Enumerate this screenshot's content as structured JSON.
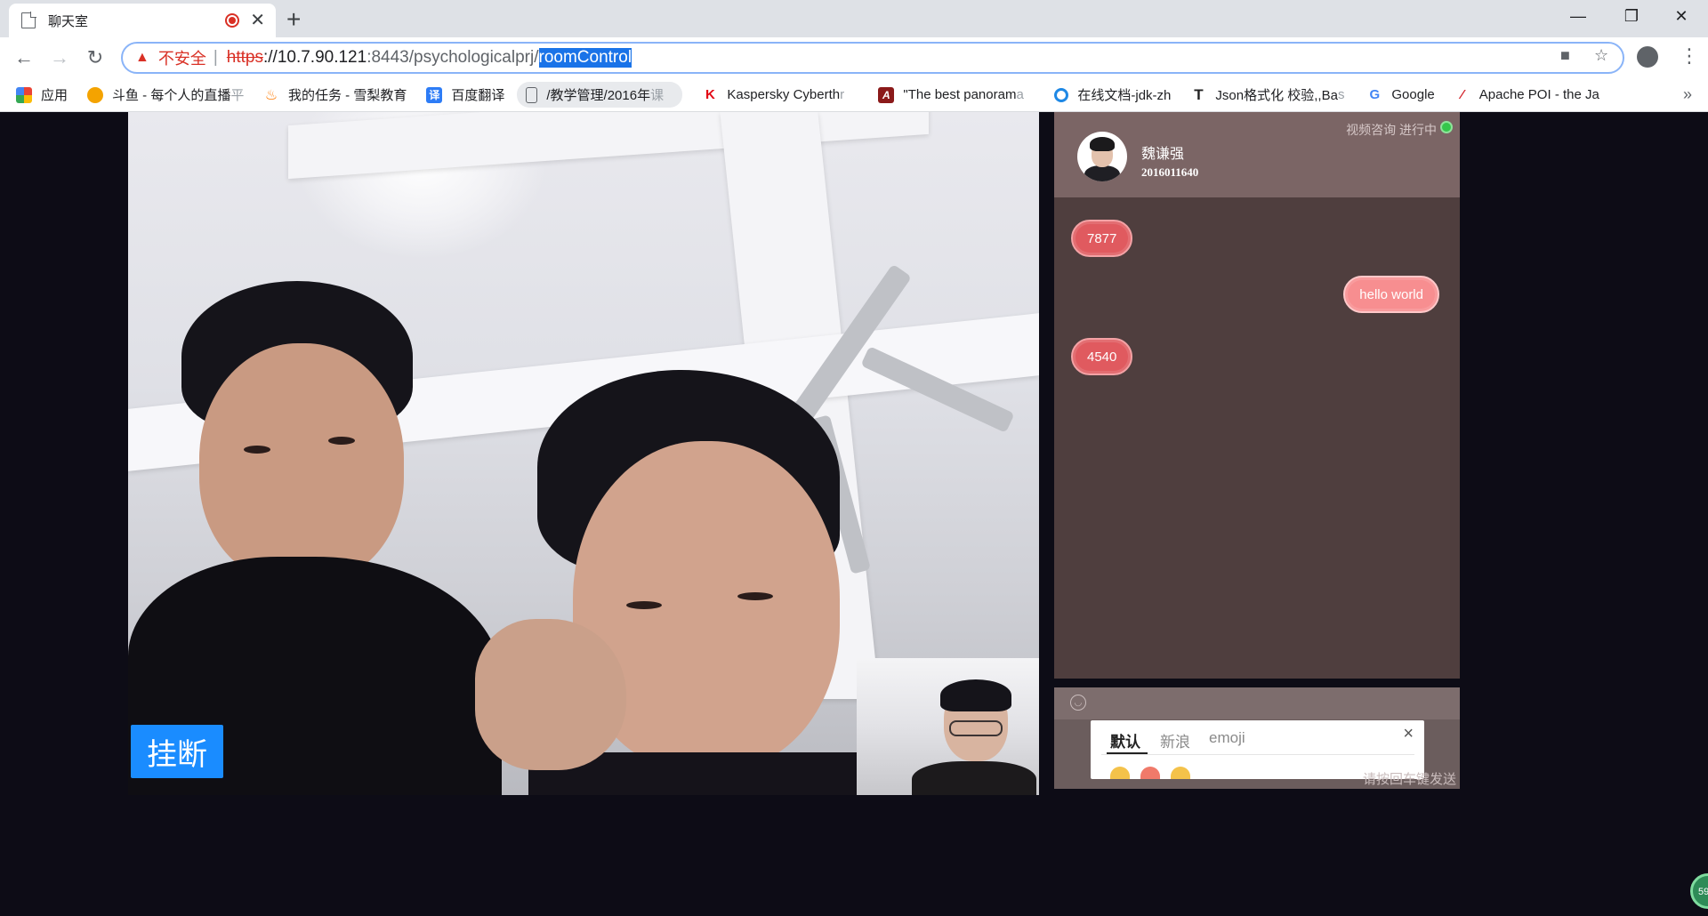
{
  "browser": {
    "tab_title": "聊天室",
    "url": {
      "insecure_label": "不安全",
      "separator": "|",
      "scheme": "https",
      "host": "://10.7.90.121",
      "path": ":8443/psychologicalprj/",
      "selected": "roomControl"
    },
    "bookmarks": [
      {
        "icon": "apps-grid-icon",
        "label": "应用"
      },
      {
        "icon": "douyu-fish-icon",
        "label": "斗鱼 - 每个人的直播",
        "fade": "平"
      },
      {
        "icon": "flame-icon",
        "label": "我的任务 - 雪梨教育"
      },
      {
        "icon": "baidu-translate-icon",
        "badge": "译",
        "label": "百度翻译"
      },
      {
        "icon": "page-icon",
        "label": "/教学管理/2016年",
        "fade": "课"
      },
      {
        "icon": "kaspersky-icon",
        "badge": "K",
        "label": "Kaspersky Cyberth",
        "fade": "r"
      },
      {
        "icon": "panorama-icon",
        "badge": "A",
        "label": "\"The best panoram",
        "fade": "a"
      },
      {
        "icon": "online-docs-icon",
        "label": "在线文档-jdk-zh"
      },
      {
        "icon": "json-tool-icon",
        "badge": "T",
        "label": "Json格式化 校验,,Ba",
        "fade": "s"
      },
      {
        "icon": "google-icon",
        "badge": "G",
        "label": "Google"
      },
      {
        "icon": "apache-feather-icon",
        "label": "Apache POI - the Ja"
      }
    ],
    "more_label": "»"
  },
  "call": {
    "hangup_label": "挂断"
  },
  "chat": {
    "name": "魏谦强",
    "id": "2016011640",
    "status": "视频咨询 进行中",
    "messages": [
      {
        "from": "other",
        "text": "7877"
      },
      {
        "from": "self",
        "text": "hello world"
      },
      {
        "from": "other",
        "text": "4540"
      }
    ]
  },
  "emoji_panel": {
    "tabs": [
      "默认",
      "新浪",
      "emoji"
    ],
    "active_tab": "默认",
    "close_label": "×"
  },
  "send_hint": "请按回车键发送",
  "corner_badge": "59",
  "colors": {
    "hangup": "#1a8cff",
    "chat_header": "#7b6565",
    "chat_body": "#4f3e3e",
    "bubble_other": "#e05a5f",
    "bubble_self": "#f78e90",
    "status_online": "#35c64b"
  }
}
